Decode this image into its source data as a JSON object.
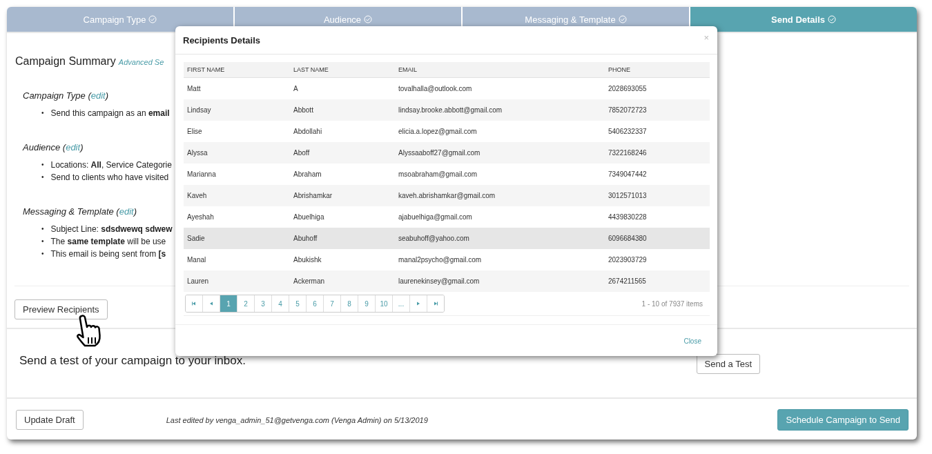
{
  "tabs": [
    {
      "label": "Campaign Type",
      "selected": false
    },
    {
      "label": "Audience",
      "selected": false
    },
    {
      "label": "Messaging & Template",
      "selected": false
    },
    {
      "label": "Send Details",
      "selected": true
    }
  ],
  "summary": {
    "title": "Campaign Summary",
    "link": "Advanced Se",
    "marker": "•",
    "sections": [
      {
        "before": "Campaign Type (",
        "link": "edit",
        "after": ")",
        "items": [
          "Send this campaign as an **email**"
        ]
      },
      {
        "before": "Audience (",
        "link": "edit",
        "after": ")",
        "items": [
          "Locations: **All**, Service Categorie",
          "Send to clients who have visited"
        ]
      },
      {
        "before": "Messaging & Template (",
        "link": "edit",
        "after": ")",
        "items": [
          "Subject Line: **sdsdwewq sdwew**",
          "The **same template** will be use",
          "This email is being sent from **[s**"
        ]
      }
    ]
  },
  "preview_button": "Preview Recipients",
  "test": {
    "text": "Send a test of your campaign to your inbox.",
    "button": "Send a Test"
  },
  "footer": {
    "update_button": "Update Draft",
    "last_edited": "Last edited by venga_admin_51@getvenga.com (Venga Admin) on 5/13/2019",
    "schedule_button": "Schedule Campaign to Send"
  },
  "modal": {
    "title": "Recipients Details",
    "close_icon": "×",
    "columns": [
      "FIRST NAME",
      "LAST NAME",
      "EMAIL",
      "PHONE"
    ],
    "rows": [
      {
        "cells": [
          "Matt",
          "A",
          "tovalhalla@outlook.com",
          "2028693055"
        ],
        "highlighted": false
      },
      {
        "cells": [
          "Lindsay",
          "Abbott",
          "lindsay.brooke.abbott@gmail.com",
          "7852072723"
        ],
        "highlighted": false
      },
      {
        "cells": [
          "Elise",
          "Abdollahi",
          "elicia.a.lopez@gmail.com",
          "5406232337"
        ],
        "highlighted": false
      },
      {
        "cells": [
          "Alyssa",
          "Aboff",
          "Alyssaaboff27@gmail.com",
          "7322168246"
        ],
        "highlighted": false
      },
      {
        "cells": [
          "Marianna",
          "Abraham",
          "msoabraham@gmail.com",
          "7349047442"
        ],
        "highlighted": false
      },
      {
        "cells": [
          "Kaveh",
          "Abrishamkar",
          "kaveh.abrishamkar@gmail.com",
          "3012571013"
        ],
        "highlighted": false
      },
      {
        "cells": [
          "Ayeshah",
          "Abuelhiga",
          "ajabuelhiga@gmail.com",
          "4439830228"
        ],
        "highlighted": false
      },
      {
        "cells": [
          "Sadie",
          "Abuhoff",
          "seabuhoff@yahoo.com",
          "6096684380"
        ],
        "highlighted": true
      },
      {
        "cells": [
          "Manal",
          "Abukishk",
          "manal2psycho@gmail.com",
          "2023903729"
        ],
        "highlighted": false
      },
      {
        "cells": [
          "Lauren",
          "Ackerman",
          "laurenekinsey@gmail.com",
          "2674211565"
        ],
        "highlighted": false
      }
    ],
    "pages": [
      {
        "label": "1",
        "selected": true
      },
      {
        "label": "2",
        "selected": false
      },
      {
        "label": "3",
        "selected": false
      },
      {
        "label": "4",
        "selected": false
      },
      {
        "label": "5",
        "selected": false
      },
      {
        "label": "6",
        "selected": false
      },
      {
        "label": "7",
        "selected": false
      },
      {
        "label": "8",
        "selected": false
      },
      {
        "label": "9",
        "selected": false
      },
      {
        "label": "10",
        "selected": false
      },
      {
        "label": "...",
        "selected": false
      }
    ],
    "item_count": "1 - 10 of 7937 items",
    "close": "Close"
  }
}
